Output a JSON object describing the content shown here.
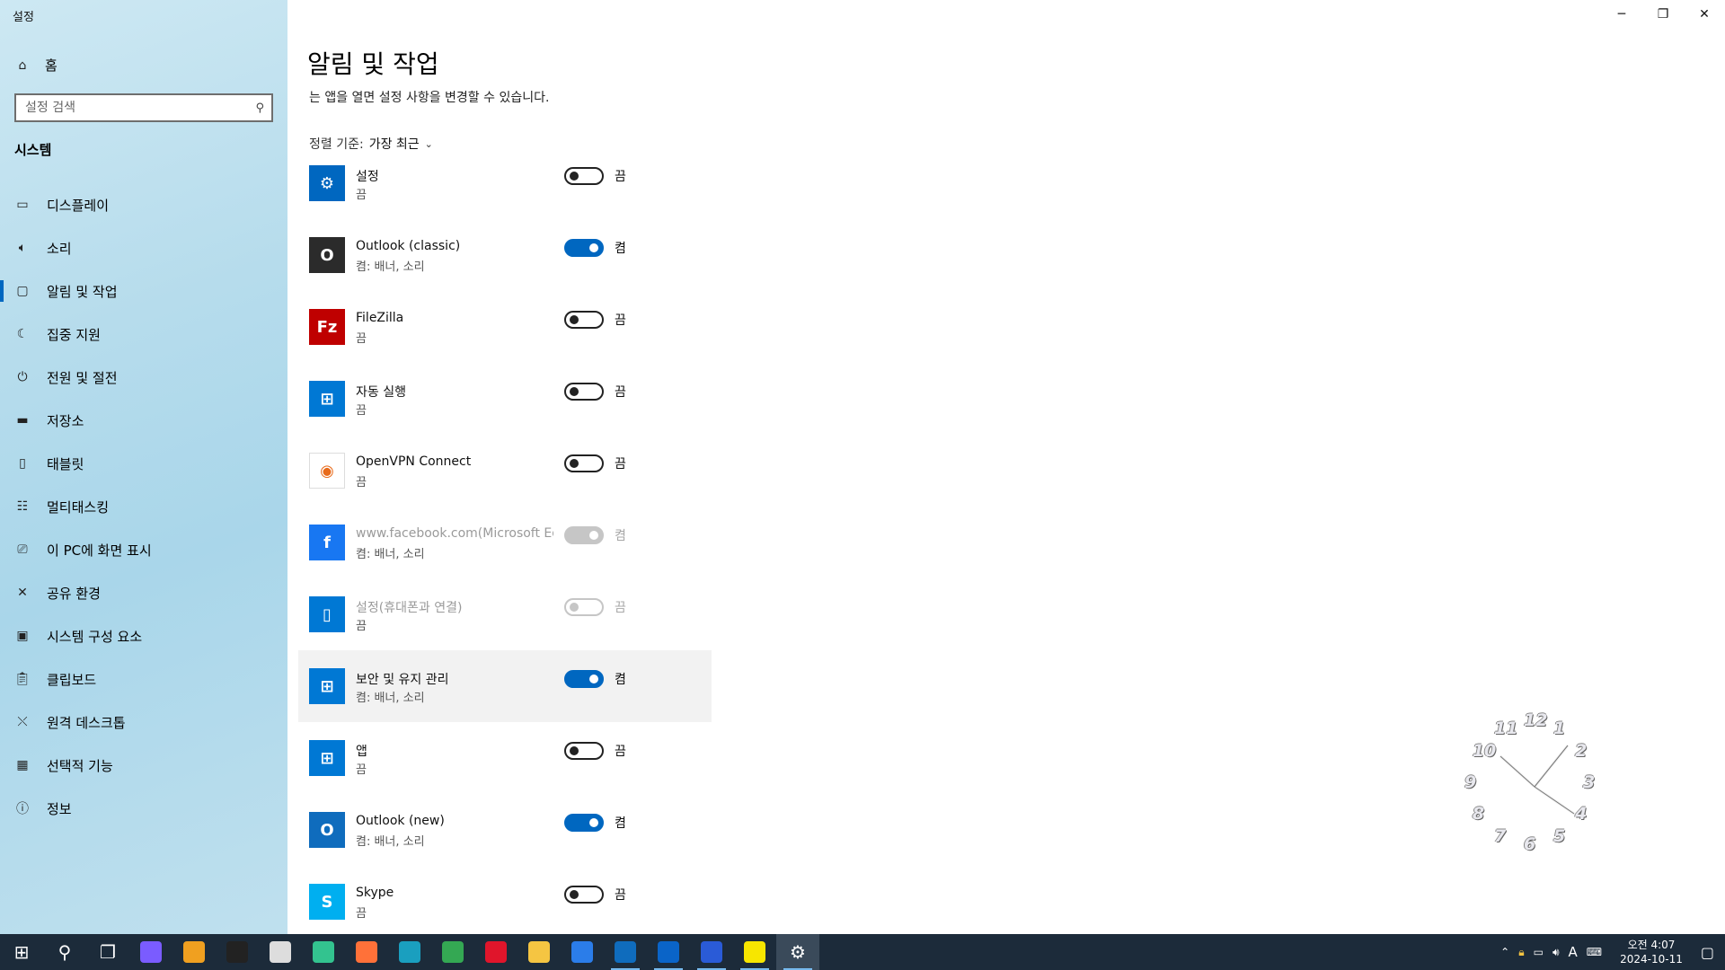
{
  "app": {
    "title": "설정"
  },
  "window_controls": {
    "minimize": "─",
    "maximize": "❐",
    "close": "✕"
  },
  "sidebar": {
    "home": "홈",
    "search_placeholder": "설정 검색",
    "section": "시스템",
    "items": [
      {
        "label": "디스플레이",
        "icon": "display-icon"
      },
      {
        "label": "소리",
        "icon": "speaker-icon"
      },
      {
        "label": "알림 및 작업",
        "icon": "notification-icon",
        "selected": true
      },
      {
        "label": "집중 지원",
        "icon": "moon-icon"
      },
      {
        "label": "전원 및 절전",
        "icon": "power-icon"
      },
      {
        "label": "저장소",
        "icon": "storage-icon"
      },
      {
        "label": "태블릿",
        "icon": "tablet-icon"
      },
      {
        "label": "멀티태스킹",
        "icon": "multitask-icon"
      },
      {
        "label": "이 PC에 화면 표시",
        "icon": "project-icon"
      },
      {
        "label": "공유 환경",
        "icon": "share-icon"
      },
      {
        "label": "시스템 구성 요소",
        "icon": "components-icon"
      },
      {
        "label": "클립보드",
        "icon": "clipboard-icon"
      },
      {
        "label": "원격 데스크톱",
        "icon": "remote-icon"
      },
      {
        "label": "선택적 기능",
        "icon": "features-icon"
      },
      {
        "label": "정보",
        "icon": "info-icon"
      }
    ]
  },
  "main": {
    "title": "알림 및 작업",
    "description": "는 앱을 열면 설정 사항을 변경할 수 있습니다.",
    "sort_label": "정렬 기준:",
    "sort_value": "가장 최근",
    "apps": [
      {
        "name": "설정",
        "sub": "끔",
        "state": "끔",
        "on": false,
        "disabled": false,
        "icon_color": "#0067c0",
        "icon": "gear-icon"
      },
      {
        "name": "Outlook (classic)",
        "sub": "켬: 배너, 소리",
        "state": "켬",
        "on": true,
        "disabled": false,
        "icon_color": "#2b2b2b",
        "icon": "outlook-icon"
      },
      {
        "name": "FileZilla",
        "sub": "끔",
        "state": "끔",
        "on": false,
        "disabled": false,
        "icon_color": "#bf0000",
        "icon": "filezilla-icon"
      },
      {
        "name": "자동 실행",
        "sub": "끔",
        "state": "끔",
        "on": false,
        "disabled": false,
        "icon_color": "#0078d4",
        "icon": "autoplay-icon"
      },
      {
        "name": "OpenVPN Connect",
        "sub": "끔",
        "state": "끔",
        "on": false,
        "disabled": false,
        "icon_color": "#ffffff",
        "icon": "openvpn-icon"
      },
      {
        "name": "www.facebook.com(Microsoft Ed...",
        "sub": "켬: 배너, 소리",
        "state": "켬",
        "on": true,
        "disabled": true,
        "icon_color": "#1877f2",
        "icon": "facebook-icon"
      },
      {
        "name": "설정(휴대폰과 연결)",
        "sub": "끔",
        "state": "끔",
        "on": false,
        "disabled": true,
        "icon_color": "#0078d4",
        "icon": "phone-link-icon"
      },
      {
        "name": "보안 및 유지 관리",
        "sub": "켬: 배너, 소리",
        "state": "켬",
        "on": true,
        "disabled": false,
        "icon_color": "#0078d4",
        "icon": "security-icon",
        "hover": true
      },
      {
        "name": "앱",
        "sub": "끔",
        "state": "끔",
        "on": false,
        "disabled": false,
        "icon_color": "#0078d4",
        "icon": "apps-icon"
      },
      {
        "name": "Outlook (new)",
        "sub": "켬: 배너, 소리",
        "state": "켬",
        "on": true,
        "disabled": false,
        "icon_color": "#0f6cbd",
        "icon": "outlook-new-icon"
      },
      {
        "name": "Skype",
        "sub": "끔",
        "state": "끔",
        "on": false,
        "disabled": false,
        "icon_color": "#00aff0",
        "icon": "skype-icon"
      }
    ]
  },
  "desktop_clock": {
    "numbers": [
      "12",
      "1",
      "2",
      "3",
      "4",
      "5",
      "6",
      "7",
      "8",
      "9",
      "10",
      "11"
    ]
  },
  "taskbar": {
    "apps": [
      {
        "name": "start-icon",
        "color": "#ffffff"
      },
      {
        "name": "search-icon",
        "color": "#ffffff"
      },
      {
        "name": "task-view-icon",
        "color": "#ffffff"
      },
      {
        "name": "copilot-icon",
        "color": "#7a5cff"
      },
      {
        "name": "ai-app-icon",
        "color": "#f0a020"
      },
      {
        "name": "app-black-icon",
        "color": "#222222"
      },
      {
        "name": "clock-app-icon",
        "color": "#dddddd"
      },
      {
        "name": "bird-app-icon",
        "color": "#33c38f"
      },
      {
        "name": "firefox-icon",
        "color": "#ff7139"
      },
      {
        "name": "edge-icon",
        "color": "#1a9fbf"
      },
      {
        "name": "chrome-icon",
        "color": "#34a853"
      },
      {
        "name": "opera-icon",
        "color": "#e0152b"
      },
      {
        "name": "file-explorer-icon",
        "color": "#f5c542"
      },
      {
        "name": "store-icon",
        "color": "#2b7de9"
      },
      {
        "name": "outlook-new-taskbar-icon",
        "color": "#0f6cbd"
      },
      {
        "name": "outlook-classic-taskbar-icon",
        "color": "#0a64c8"
      },
      {
        "name": "app-blue-icon",
        "color": "#2a5bd7"
      },
      {
        "name": "kakaotalk-icon",
        "color": "#f7e600"
      },
      {
        "name": "settings-taskbar-icon",
        "color": "#ffffff"
      }
    ],
    "tray": {
      "time": "오전 4:07",
      "date": "2024-10-11",
      "ime": "A"
    }
  }
}
